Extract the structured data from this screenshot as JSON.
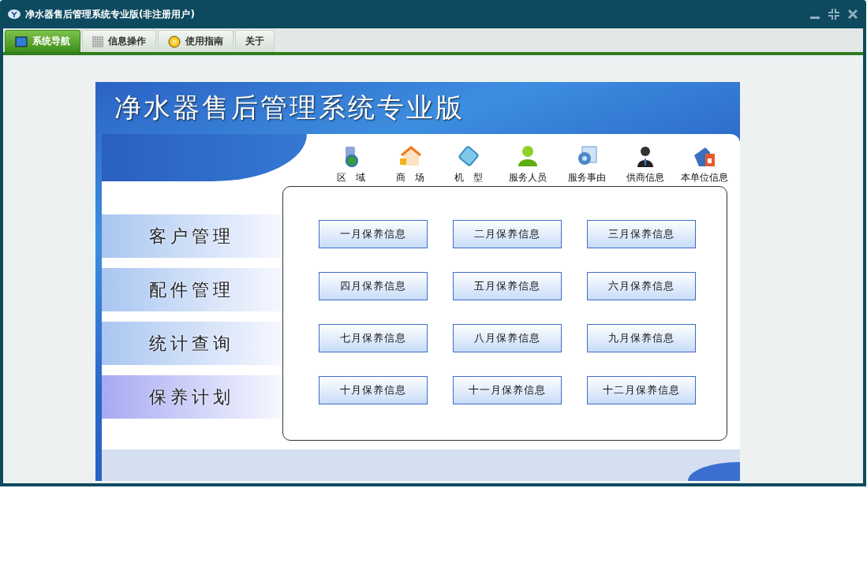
{
  "window": {
    "title": "净水器售后管理系统专业版(非注册用户)"
  },
  "tabs": [
    {
      "label": "系统导航",
      "kind": "monitor",
      "selected": true
    },
    {
      "label": "信息操作",
      "kind": "grid",
      "selected": false
    },
    {
      "label": "使用指南",
      "kind": "help",
      "selected": false
    },
    {
      "label": "关于",
      "kind": "none",
      "selected": false
    }
  ],
  "banner": {
    "title": "净水器售后管理系统专业版"
  },
  "shortcuts": [
    {
      "label": "区　域",
      "kind": "globe"
    },
    {
      "label": "商　场",
      "kind": "store"
    },
    {
      "label": "机　型",
      "kind": "device"
    },
    {
      "label": "服务人员",
      "kind": "person"
    },
    {
      "label": "服务事由",
      "kind": "gear"
    },
    {
      "label": "供商信息",
      "kind": "suit"
    },
    {
      "label": "本单位信息",
      "kind": "house"
    }
  ],
  "sidebar": {
    "items": [
      {
        "label": "客户管理",
        "selected": false
      },
      {
        "label": "配件管理",
        "selected": false
      },
      {
        "label": "统计查询",
        "selected": false
      },
      {
        "label": "保养计划",
        "selected": true
      }
    ]
  },
  "month_buttons": [
    "一月保养信息",
    "二月保养信息",
    "三月保养信息",
    "四月保养信息",
    "五月保养信息",
    "六月保养信息",
    "七月保养信息",
    "八月保养信息",
    "九月保养信息",
    "十月保养信息",
    "十一月保养信息",
    "十二月保养信息"
  ]
}
